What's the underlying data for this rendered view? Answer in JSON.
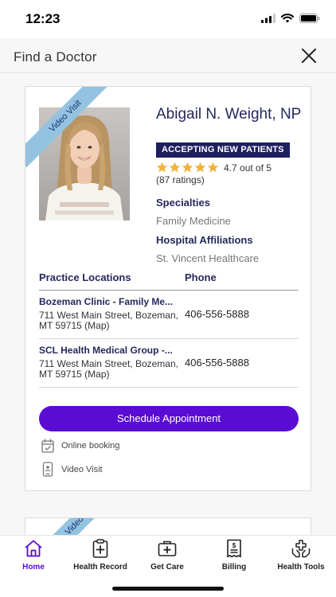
{
  "status_bar": {
    "time": "12:23"
  },
  "header": {
    "title": "Find a Doctor"
  },
  "doctor": {
    "ribbon": "Video Visit",
    "name": "Abigail N. Weight, NP",
    "badge": "ACCEPTING NEW PATIENTS",
    "rating_value": 4.7,
    "rating_text": "4.7 out of 5",
    "rating_count": "(87 ratings)",
    "specialties_label": "Specialties",
    "specialties_value": "Family Medicine",
    "affiliations_label": "Hospital Affiliations",
    "affiliations_value": "St. Vincent Healthcare"
  },
  "locations": {
    "col_location": "Practice Locations",
    "col_phone": "Phone",
    "rows": [
      {
        "name": "Bozeman Clinic - Family Me...",
        "address": "711 West Main Street, Bozeman, MT 59715 (Map)",
        "phone": "406-556-5888"
      },
      {
        "name": "SCL Health Medical Group -...",
        "address": "711 West Main Street, Bozeman, MT 59715 (Map)",
        "phone": "406-556-5888"
      }
    ]
  },
  "actions": {
    "schedule": "Schedule Appointment",
    "feature_online": "Online booking",
    "feature_video": "Video Visit"
  },
  "next_card": {
    "ribbon": "Video Visit"
  },
  "tabs": [
    {
      "label": "Home",
      "icon": "home-icon",
      "active": true
    },
    {
      "label": "Health Record",
      "icon": "clipboard-plus-icon",
      "active": false
    },
    {
      "label": "Get Care",
      "icon": "medical-bag-icon",
      "active": false
    },
    {
      "label": "Billing",
      "icon": "bill-icon",
      "active": false
    },
    {
      "label": "Health Tools",
      "icon": "hands-cross-icon",
      "active": false
    }
  ],
  "colors": {
    "accent": "#5a0bd4",
    "navy": "#24285c",
    "badge": "#1d1f5e",
    "ribbon": "#93c3e1",
    "star": "#f2b138"
  }
}
